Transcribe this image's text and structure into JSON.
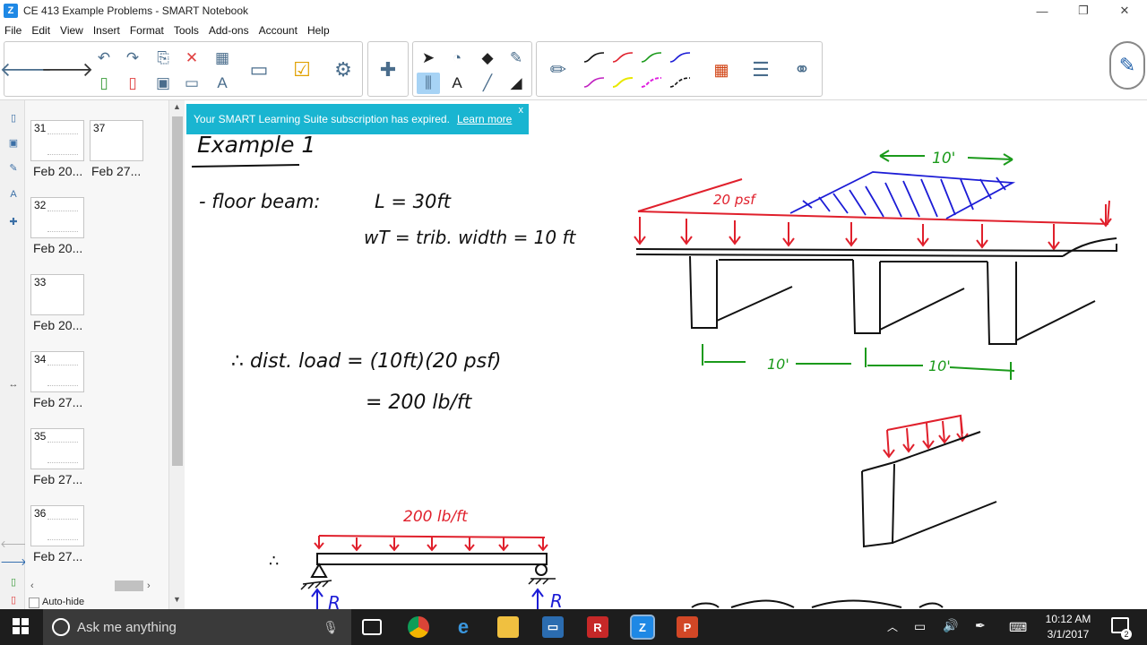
{
  "window": {
    "title": "CE 413 Example Problems - SMART Notebook",
    "minimize": "—",
    "restore": "❐",
    "close": "✕"
  },
  "menu": [
    "File",
    "Edit",
    "View",
    "Insert",
    "Format",
    "Tools",
    "Add-ons",
    "Account",
    "Help"
  ],
  "colors": {
    "accent_blue": "#19b5d1",
    "ink_black": "#111111",
    "ink_red": "#e0202c",
    "ink_blue": "#1c1cd6",
    "ink_green": "#1b9a1b"
  },
  "toolbar": {
    "icons": [
      "back-arrow-icon",
      "forward-arrow-icon",
      "undo-icon",
      "redo-icon",
      "paste-icon",
      "delete-icon",
      "table-icon",
      "add-page-icon",
      "remove-page-icon",
      "save-icon",
      "screen-shade-icon",
      "text-format-icon",
      "document-camera-icon",
      "response-icon",
      "widgets-icon",
      "addons-icon",
      "select-icon",
      "shape-icon",
      "fill-icon",
      "magic-pen-icon",
      "measure-tools-icon",
      "text-icon",
      "line-icon",
      "eraser-icon",
      "pen-icon",
      "color-grid-icon",
      "properties-icon",
      "link-icon"
    ]
  },
  "pages": [
    {
      "num": "31",
      "label": "Feb 20..."
    },
    {
      "num": "37",
      "label": "Feb 27..."
    },
    {
      "num": "32",
      "label": "Feb 20..."
    },
    {
      "num": "33",
      "label": "Feb 20..."
    },
    {
      "num": "34",
      "label": "Feb 27..."
    },
    {
      "num": "35",
      "label": "Feb 27..."
    },
    {
      "num": "36",
      "label": "Feb 27..."
    }
  ],
  "sorter": {
    "auto_hide": "Auto-hide"
  },
  "banner": {
    "message": "Your SMART Learning Suite subscription has expired.",
    "link": "Learn more",
    "close": "x"
  },
  "notes": {
    "heading": "Example 1",
    "line1_label": "- floor beam:",
    "line1_value": "L = 30ft",
    "line2": "wT = trib. width = 10 ft",
    "line3": "∴ dist. load = (10ft)(20 psf)",
    "line4": "= 200 lb/ft",
    "load_label_top": "20 psf",
    "dim_top": "← 10' →",
    "dim_bottom_1": "10'",
    "dim_bottom_2": "10'",
    "beam_load": "200 lb/ft",
    "reaction_left": "R",
    "reaction_right": "R",
    "therefore": "∴"
  },
  "taskbar": {
    "search_placeholder": "Ask me anything",
    "time": "10:12 AM",
    "date": "3/1/2017",
    "notification_count": "2"
  }
}
